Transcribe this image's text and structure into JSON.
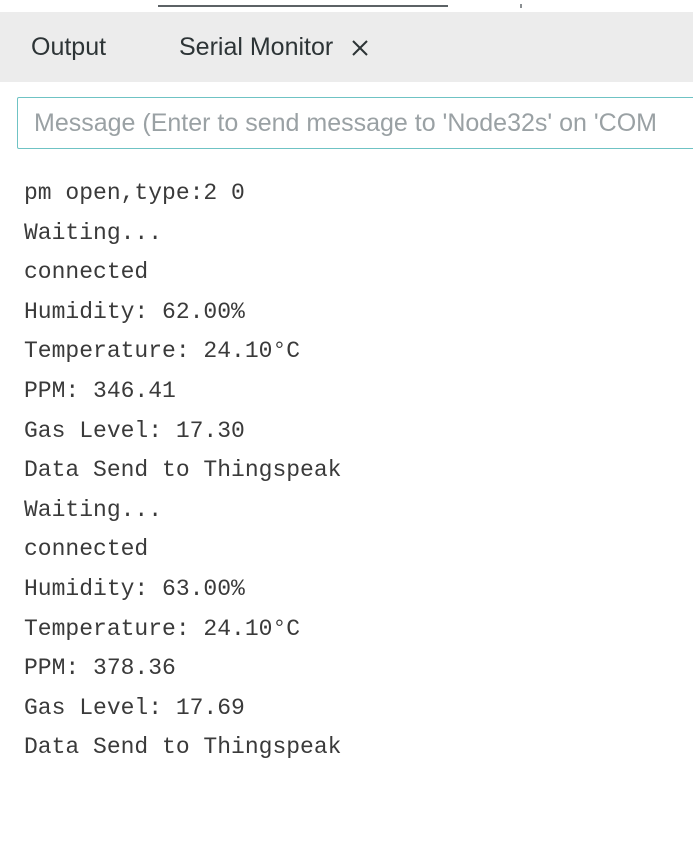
{
  "tabs": [
    {
      "label": "Output"
    },
    {
      "label": "Serial Monitor"
    }
  ],
  "message_input": {
    "placeholder": "Message (Enter to send message to 'Node32s' on 'COM",
    "value": ""
  },
  "console_lines": [
    "pm open,type:2 0",
    "Waiting...",
    "connected",
    "Humidity: 62.00%",
    "Temperature: 24.10°C",
    "PPM: 346.41",
    "Gas Level: 17.30",
    "Data Send to Thingspeak",
    "Waiting...",
    "connected",
    "Humidity: 63.00%",
    "Temperature: 24.10°C",
    "PPM: 378.36",
    "Gas Level: 17.69",
    "Data Send to Thingspeak"
  ],
  "icons": {
    "close": "close-icon"
  },
  "colors": {
    "tabbar_bg": "#ececec",
    "input_border": "#6fc3c4",
    "console_text": "#3a3a3a"
  }
}
